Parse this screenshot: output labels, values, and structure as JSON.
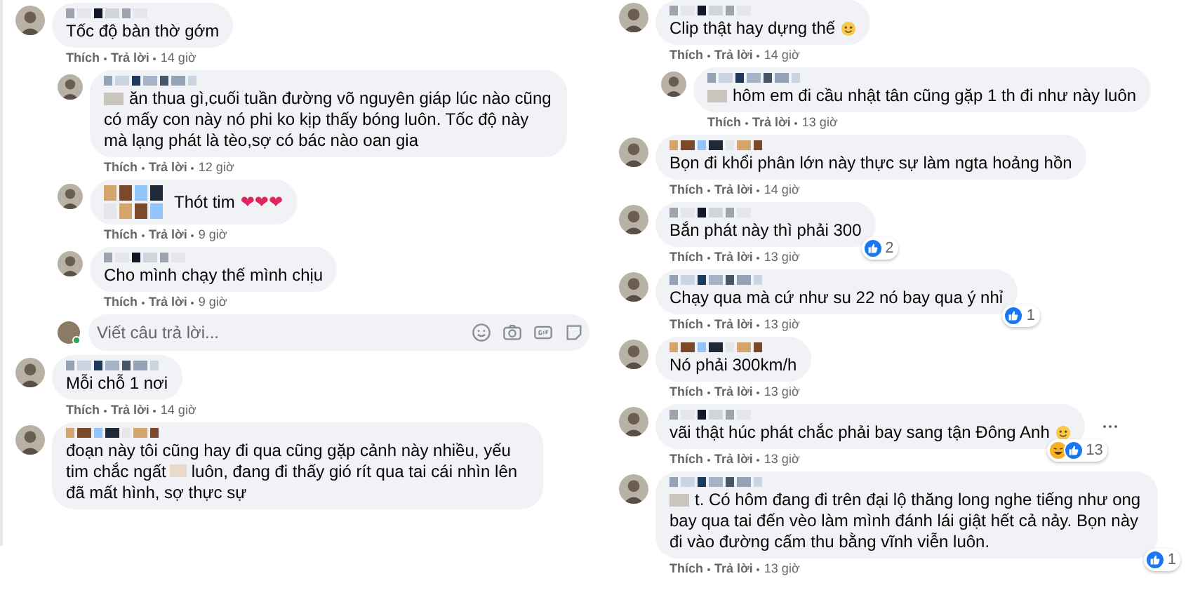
{
  "columns": [
    {
      "comments": [
        {
          "text": "Tốc độ bàn thờ gớm",
          "actions": [
            "Thích",
            "Trả lời"
          ],
          "time": "14 giờ",
          "replies": [
            {
              "text": "ăn thua gì,cuối tuần đường võ nguyên giáp lúc nào cũng có mấy con này nó phi ko kịp thấy bóng luôn. Tốc độ này mà lạng phát là tèo,sợ có bác nào oan gia",
              "text_start_hidden": true,
              "actions": [
                "Thích",
                "Trả lời"
              ],
              "time": "12 giờ"
            },
            {
              "text": "Thót tim",
              "emoji": "❤❤❤",
              "tall_name": true,
              "actions": [
                "Thích",
                "Trả lời"
              ],
              "time": "9 giờ"
            },
            {
              "text": "Cho mình chạy thế mình chịu",
              "actions": [
                "Thích",
                "Trả lời"
              ],
              "time": "9 giờ"
            }
          ],
          "reply_box": {
            "placeholder": "Viết câu trả lời..."
          }
        },
        {
          "text": "Mỗi chỗ 1 nơi",
          "actions": [
            "Thích",
            "Trả lời"
          ],
          "time": "14 giờ"
        },
        {
          "text": "đoạn này tôi cũng hay đi qua cũng gặp cảnh này nhiều, yếu tim chắc ngất",
          "text_after_hidden": "luôn, đang đi thấy gió rít qua tai cái nhìn lên đã mất hình, sợ thực sự"
        }
      ]
    },
    {
      "comments": [
        {
          "text": "Clip thật hay dựng thế",
          "emoji_icon": true,
          "actions": [
            "Thích",
            "Trả lời"
          ],
          "time": "14 giờ",
          "replies": [
            {
              "text": "hôm em đi cầu nhật tân cũng gặp 1 th đi như này luôn",
              "text_start_hidden": true,
              "actions": [
                "Thích",
                "Trả lời"
              ],
              "time": "13 giờ"
            }
          ]
        },
        {
          "text": "Bọn đi khổi phân lớn này thực sự làm ngta hoảng hồn",
          "actions": [
            "Thích",
            "Trả lời"
          ],
          "time": "14 giờ"
        },
        {
          "text": "Bắn phát này thì phải 300",
          "actions": [
            "Thích",
            "Trả lời"
          ],
          "time": "13 giờ",
          "reactions": {
            "icons": [
              {
                "kind": "like"
              }
            ],
            "count": "2"
          }
        },
        {
          "text": "Chạy qua mà cứ như su 22 nó bay qua ý nhỉ",
          "actions": [
            "Thích",
            "Trả lời"
          ],
          "time": "13 giờ",
          "reactions": {
            "icons": [
              {
                "kind": "like"
              }
            ],
            "count": "1"
          }
        },
        {
          "text": "Nó phải 300km/h",
          "actions": [
            "Thích",
            "Trả lời"
          ],
          "time": "13 giờ"
        },
        {
          "text": "vãi thật húc phát chắc phải bay sang tận Đông Anh",
          "emoji_icon": true,
          "show_more": true,
          "actions": [
            "Thích",
            "Trả lời"
          ],
          "time": "13 giờ",
          "reactions": {
            "icons": [
              {
                "kind": "haha"
              },
              {
                "kind": "like"
              }
            ],
            "count": "13"
          }
        },
        {
          "text": "t. Có hôm đang đi trên đại lộ thăng long nghe tiếng như ong bay qua tai đến vèo làm mình đánh lái giật hết cả nảy. Bọn này đi vào đường cấm thu bằng vĩnh viễn luôn.",
          "text_start_hidden": true,
          "actions": [
            "Thích",
            "Trả lời"
          ],
          "time": "13 giờ",
          "reactions": {
            "icons": [
              {
                "kind": "like"
              }
            ],
            "count": "1"
          }
        }
      ]
    }
  ]
}
